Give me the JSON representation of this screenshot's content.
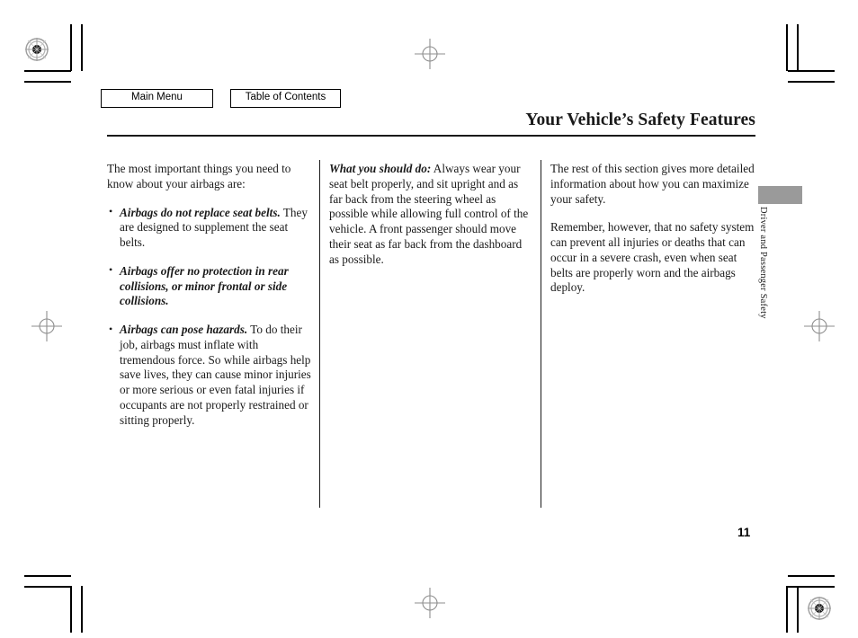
{
  "nav": {
    "main_menu_label": "Main Menu",
    "table_of_contents_label": "Table of Contents"
  },
  "header": {
    "title": "Your Vehicle’s Safety Features"
  },
  "columns": {
    "left": {
      "intro": "The most important things you need to know about your airbags are:",
      "bullets": [
        {
          "lead": "Airbags do not replace seat belts.",
          "rest": " They are designed to supplement the seat belts."
        },
        {
          "lead": "Airbags offer no protection in rear collisions, or minor frontal or side collisions.",
          "rest": ""
        },
        {
          "lead": "Airbags can pose hazards.",
          "rest": " To do their job, airbags must inflate with tremendous force. So while airbags help save lives, they can cause minor injuries or more serious or even fatal injuries if occupants are not properly restrained or sitting properly."
        }
      ]
    },
    "middle": {
      "lead": "What you should do:",
      "body": " Always wear your seat belt properly, and sit upright and as far back from the steering wheel as possible while allowing full control of the vehicle. A front passenger should move their seat as far back from the dashboard as possible."
    },
    "right": {
      "para1": "The rest of this section gives more detailed information about how you can maximize your safety.",
      "para2": "Remember, however, that no safety system can prevent all injuries or deaths that can occur in a severe crash, even when seat belts are properly worn and the airbags deploy."
    }
  },
  "side_tab": {
    "label": "Driver and Passenger Safety",
    "color": "#9a9a9a"
  },
  "footer": {
    "page_number": "11"
  }
}
